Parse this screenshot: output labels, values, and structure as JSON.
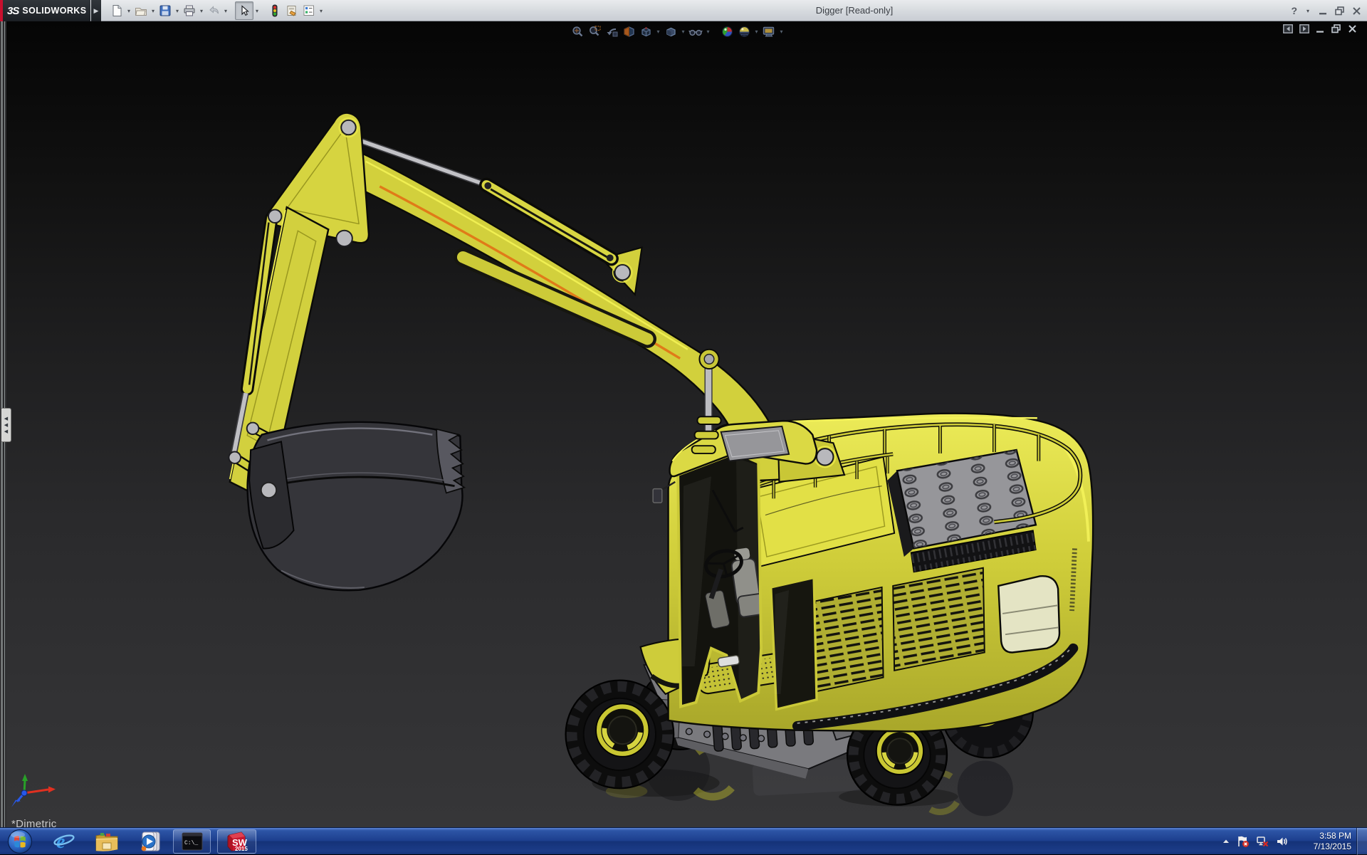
{
  "window": {
    "brand_mark": "3S",
    "brand": "SOLIDWORKS",
    "title": "Digger [Read-only]",
    "help": "?"
  },
  "main_toolbar": {
    "icons": [
      "new-document",
      "open",
      "save",
      "print",
      "undo",
      "select",
      "rebuild",
      "file-properties",
      "options"
    ]
  },
  "headsup_toolbar": {
    "icons": [
      "zoom-to-fit",
      "zoom-to-area",
      "previous-view",
      "section-view",
      "view-orientation",
      "display-style",
      "hide-show-items",
      "edit-appearance",
      "apply-scene",
      "view-settings"
    ]
  },
  "document_controls": {
    "icons": [
      "dock-left",
      "dock-right",
      "minimize-document",
      "restore-document",
      "close-document"
    ]
  },
  "viewport": {
    "orientation_label": "*Dimetric",
    "model_name": "Digger",
    "background_top": "#050505",
    "background_bottom": "#363638",
    "model_color": "#d3d13c",
    "triad_colors": {
      "x": "#e03020",
      "y": "#28a028",
      "z": "#2858e8"
    }
  },
  "taskbar": {
    "background": "#1d3f8e",
    "items": [
      "start",
      "internet-explorer",
      "windows-explorer",
      "media-player",
      "command-prompt",
      "solidworks-2015"
    ],
    "command_prompt_label": "C:\\_",
    "solidworks_letters": "SW",
    "solidworks_year": "2015",
    "tray_icons": [
      "show-hidden-icons",
      "action-center-flag",
      "network-error",
      "speaker"
    ],
    "clock": {
      "time": "3:58 PM",
      "date": "7/13/2015"
    }
  }
}
